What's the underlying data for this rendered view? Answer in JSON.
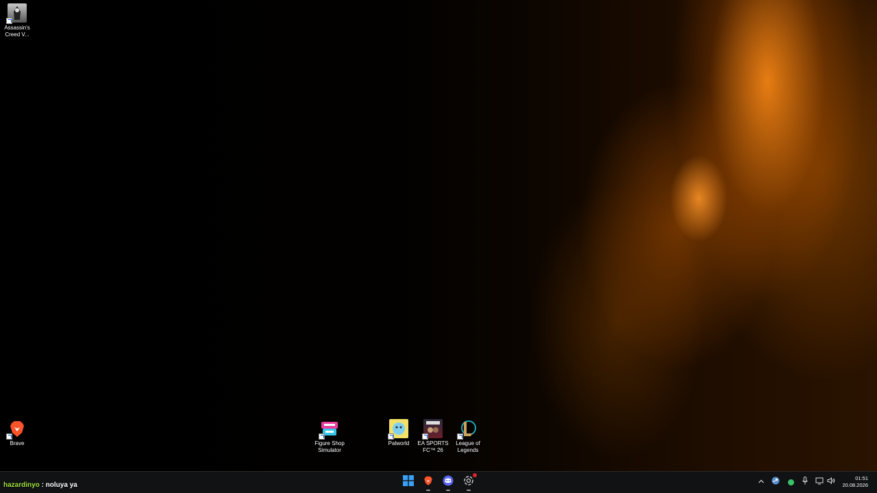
{
  "desktop": {
    "icons": [
      {
        "label": "Assassin's Creed V..."
      },
      {
        "label": "Brave"
      },
      {
        "label": "Figure Shop Simulator"
      },
      {
        "label": "Palworld"
      },
      {
        "label": "EA SPORTS FC™ 26"
      },
      {
        "label": "League of Legends"
      }
    ]
  },
  "overlay": {
    "username": "hazardinyo",
    "message": ": noluya ya"
  },
  "taskbar": {
    "apps": [
      "start-icon",
      "brave-icon",
      "discord-icon",
      "chatgpt-icon"
    ]
  },
  "tray": {
    "icons": [
      "chevron-up-icon",
      "steam-icon",
      "status-dot-icon",
      "microphone-icon",
      "display-icon",
      "speaker-icon"
    ],
    "time": "01:51",
    "date": "20.08.2026"
  },
  "colors": {
    "username": "#a2e33a",
    "brave": "#fb542b",
    "discord": "#5865f2",
    "start": "#3aa0f3",
    "status_dot": "#39c46a",
    "notification_badge": "#e0242f"
  }
}
